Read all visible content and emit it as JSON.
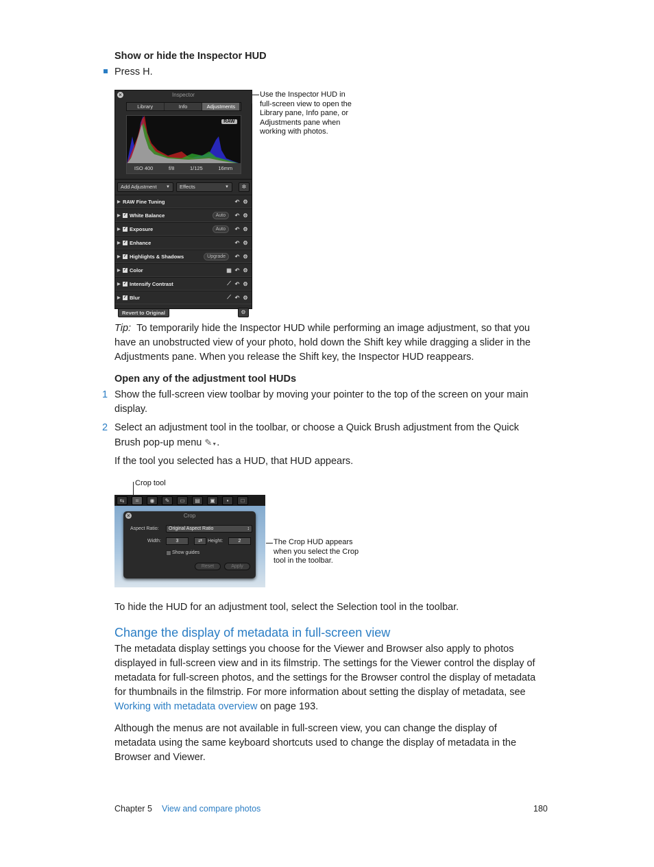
{
  "section1": {
    "heading": "Show or hide the Inspector HUD",
    "bullet": "Press H."
  },
  "inspector_hud": {
    "title": "Inspector",
    "tabs": [
      "Library",
      "Info",
      "Adjustments"
    ],
    "active_tab": "Adjustments",
    "raw_badge": "RAW",
    "meta": [
      "ISO 400",
      "f/8",
      "1/125",
      "16mm"
    ],
    "add_adjustment": "Add Adjustment",
    "effects": "Effects",
    "adjustments": [
      {
        "label": "RAW Fine Tuning",
        "checkbox": false,
        "control": ""
      },
      {
        "label": "White Balance",
        "checkbox": true,
        "control": "Auto"
      },
      {
        "label": "Exposure",
        "checkbox": true,
        "control": "Auto"
      },
      {
        "label": "Enhance",
        "checkbox": true,
        "control": ""
      },
      {
        "label": "Highlights & Shadows",
        "checkbox": true,
        "control": "Upgrade"
      },
      {
        "label": "Color",
        "checkbox": true,
        "control": "swatch-icon"
      },
      {
        "label": "Intensify Contrast",
        "checkbox": true,
        "control": "brush-icon"
      },
      {
        "label": "Blur",
        "checkbox": true,
        "control": "brush-icon"
      }
    ],
    "revert_button": "Revert to Original"
  },
  "callout1": "Use the Inspector HUD in full-screen view to open the Library pane, Info pane, or Adjustments pane when working with photos.",
  "tip": {
    "label": "Tip:",
    "text": "To temporarily hide the Inspector HUD while performing an image adjustment, so that you have an unobstructed view of your photo, hold down the Shift key while dragging a slider in the Adjustments pane. When you release the Shift key, the Inspector HUD reappears."
  },
  "section2": {
    "heading": "Open any of the adjustment tool HUDs",
    "steps": [
      {
        "num": "1",
        "text": "Show the full-screen view toolbar by moving your pointer to the top of the screen on your main display."
      },
      {
        "num": "2",
        "text": "Select an adjustment tool in the toolbar, or choose a Quick Brush adjustment from the Quick Brush pop-up menu"
      }
    ],
    "after": "If the tool you selected has a HUD, that HUD appears."
  },
  "crop_figure": {
    "label_top": "Crop tool",
    "hud_title": "Crop",
    "aspect_label": "Aspect Ratio:",
    "aspect_value": "Original Aspect Ratio",
    "width_label": "Width:",
    "width_value": "3",
    "height_label": "Height:",
    "height_value": "2",
    "show_guides": "Show guides",
    "reset": "Reset",
    "apply": "Apply",
    "callout": "The Crop HUD appears when you select the Crop tool in the toolbar."
  },
  "hide_hud_text": "To hide the HUD for an adjustment tool, select the Selection tool in the toolbar.",
  "section3": {
    "heading": "Change the display of metadata in full-screen view",
    "para1": "The metadata display settings you choose for the Viewer and Browser also apply to photos displayed in full-screen view and in its filmstrip. The settings for the Viewer control the display of metadata for full-screen photos, and the settings for the Browser control the display of metadata for thumbnails in the filmstrip. For more information about setting the display of metadata, see",
    "para1_link": "Working with metadata overview",
    "para1_end": " on page 193.",
    "para2": "Although the menus are not available in full-screen view, you can change the display of metadata using the same keyboard shortcuts used to change the display of metadata in the Browser and Viewer."
  },
  "footer": {
    "chapter": "Chapter 5",
    "chapter_title": "View and compare photos",
    "page": "180"
  },
  "colors": {
    "accent": "#2a7dc4"
  }
}
